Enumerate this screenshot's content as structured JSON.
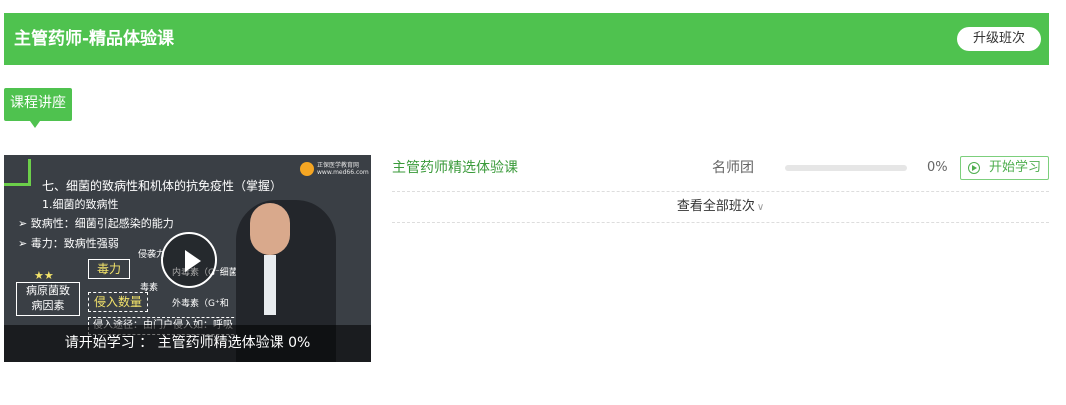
{
  "header": {
    "title": "主管药师-精品体验课",
    "upgrade_label": "升级班次"
  },
  "section_tag": "课程讲座",
  "video": {
    "overlay_text": "请开始学习 ： 主管药师精选体验课 0%",
    "slide": {
      "heading": "七、细菌的致病性和机体的抗免疫性（掌握）",
      "sub": "1.细菌的致病性",
      "bullet1": "➢  致病性：细菌引起感染的能力",
      "bullet2": "➢  毒力：致病性强弱",
      "stars": "★★",
      "factor_box": "病原菌致\n病因素",
      "virulence": "毒力",
      "invasion_count": "侵入数量",
      "invasion_route": "侵入途径：由门户侵入如：呼吸",
      "invasive": "侵袭力",
      "toxin": "毒素",
      "endotoxin": "内毒素（G⁻细菌）",
      "exotoxin": "外毒素（G⁺和",
      "logo_text": "正保医学教育网 www.med66.com"
    }
  },
  "course": {
    "name": "主管药师精选体验课",
    "teacher": "名师团",
    "progress": 0,
    "percent_text": "0%",
    "start_label": "开始学习"
  },
  "view_all_label": "查看全部班次",
  "colors": {
    "brand_green": "#4fc24f",
    "link_green": "#3a9a3a"
  }
}
